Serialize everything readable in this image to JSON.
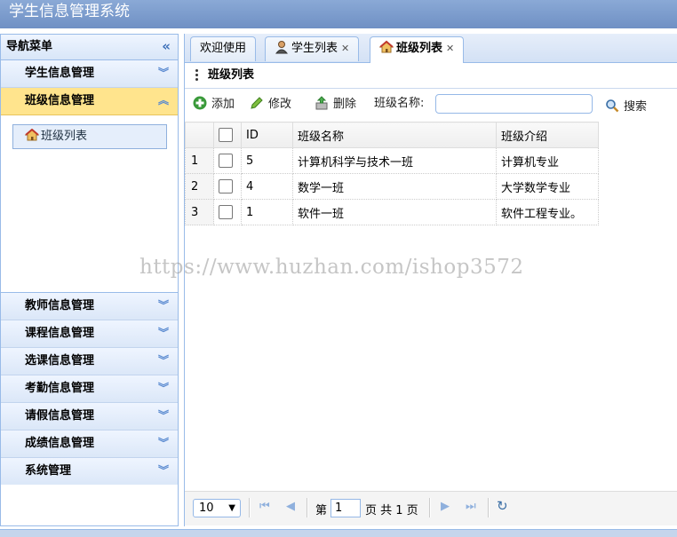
{
  "app": {
    "title": "学生信息管理系统"
  },
  "sidebar": {
    "header": "导航菜单",
    "active_panel": {
      "title": "班级信息管理",
      "item": "班级列表"
    },
    "top_panels": [
      "学生信息管理"
    ],
    "bottom_panels": [
      "教师信息管理",
      "课程信息管理",
      "选课信息管理",
      "考勤信息管理",
      "请假信息管理",
      "成绩信息管理",
      "系统管理"
    ]
  },
  "tabs": [
    {
      "label": "欢迎使用",
      "icon": "",
      "closable": false
    },
    {
      "label": "学生列表",
      "icon": "user-icon",
      "closable": true
    },
    {
      "label": "班级列表",
      "icon": "house-icon",
      "closable": true
    }
  ],
  "list": {
    "title": "班级列表",
    "toolbar": {
      "add": "添加",
      "edit": "修改",
      "delete": "删除",
      "name_label": "班级名称:",
      "search_placeholder": "",
      "search": "搜索"
    },
    "columns": [
      "ID",
      "班级名称",
      "班级介绍"
    ],
    "rows": [
      {
        "num": "1",
        "id": "5",
        "name": "计算机科学与技术一班",
        "intro": "计算机专业"
      },
      {
        "num": "2",
        "id": "4",
        "name": "数学一班",
        "intro": "大学数学专业"
      },
      {
        "num": "3",
        "id": "1",
        "name": "软件一班",
        "intro": "软件工程专业。"
      }
    ]
  },
  "pager": {
    "page_size": "10",
    "page_prefix": "第",
    "page_value": "1",
    "page_suffix": "页 共 1 页"
  },
  "watermark": "https://www.huzhan.com/ishop3572",
  "colors": {
    "accent": "#99bbe8",
    "active_panel": "#ffe48d",
    "topbar": "#7b9bcd"
  }
}
